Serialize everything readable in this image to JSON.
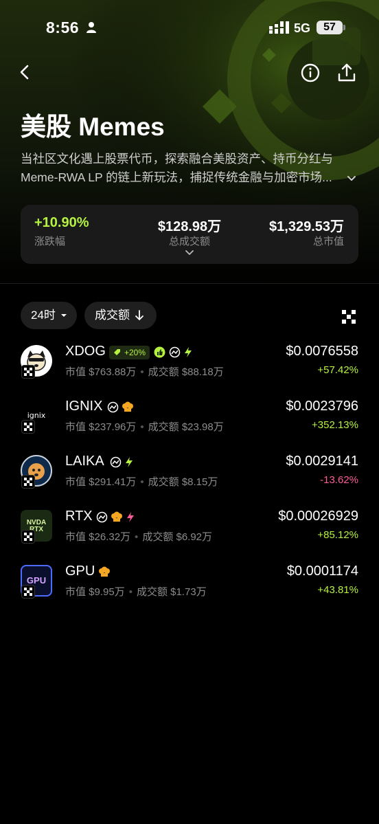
{
  "status_bar": {
    "time": "8:56",
    "network": "5G",
    "battery": "57"
  },
  "header": {
    "title": "美股 Memes",
    "description_line1": "当社区文化遇上股票代币，探索融合美股资产、持币分红与",
    "description_line2": "Meme-RWA LP 的链上新玩法，捕捉传统金融与加密市场..."
  },
  "stats": {
    "change_value": "+10.90%",
    "change_label": "涨跌幅",
    "volume_value": "$128.98万",
    "volume_label": "总成交额",
    "market_cap_value": "$1,329.53万",
    "market_cap_label": "总市值"
  },
  "filters": {
    "period": "24时",
    "sort": "成交额"
  },
  "colors": {
    "accent_green": "#b5f240",
    "negative_pink": "#ff5c9a"
  },
  "tokens": [
    {
      "name": "XDOG",
      "boost": "+20%",
      "market_cap": "市值 $763.88万",
      "volume": "成交额 $88.18万",
      "price": "$0.0076558",
      "change": "+57.42%"
    },
    {
      "name": "IGNIX",
      "logo_text": "ignix",
      "market_cap": "市值 $237.96万",
      "volume": "成交额 $23.98万",
      "price": "$0.0023796",
      "change": "+352.13%"
    },
    {
      "name": "LAIKA",
      "market_cap": "市值 $291.41万",
      "volume": "成交额 $8.15万",
      "price": "$0.0029141",
      "change": "-13.62%"
    },
    {
      "name": "RTX",
      "logo_text": "NVDA RTX",
      "market_cap": "市值 $26.32万",
      "volume": "成交额 $6.92万",
      "price": "$0.00026929",
      "change": "+85.12%"
    },
    {
      "name": "GPU",
      "logo_text": "GPU",
      "market_cap": "市值 $9.95万",
      "volume": "成交额 $1.73万",
      "price": "$0.0001174",
      "change": "+43.81%"
    }
  ]
}
